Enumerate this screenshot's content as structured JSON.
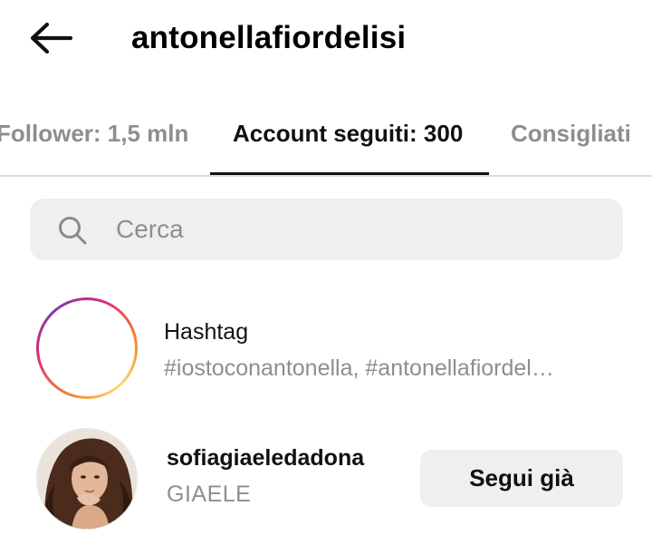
{
  "header": {
    "back_icon": "arrow-left-icon",
    "title": "antonellafiordelisi"
  },
  "tabs": [
    {
      "label": "Follower: 1,5 mln",
      "active": false
    },
    {
      "label": "Account seguiti: 300",
      "active": true
    },
    {
      "label": "Consigliati",
      "active": false
    }
  ],
  "search": {
    "icon": "search-icon",
    "placeholder": "Cerca",
    "value": ""
  },
  "list": {
    "hashtag_row": {
      "icon": "hashtag-icon",
      "title": "Hashtag",
      "subtitle": "#iostoconantonella, #antonellafiordel…"
    },
    "account_row": {
      "username": "sofiagiaeledadona",
      "display_name": "GIAELE",
      "button_label": "Segui già"
    }
  },
  "colors": {
    "muted_text": "#8e8e8e",
    "field_bg": "#efefef",
    "gradient": [
      "#f58529",
      "#dd2a7b",
      "#8134af"
    ]
  }
}
